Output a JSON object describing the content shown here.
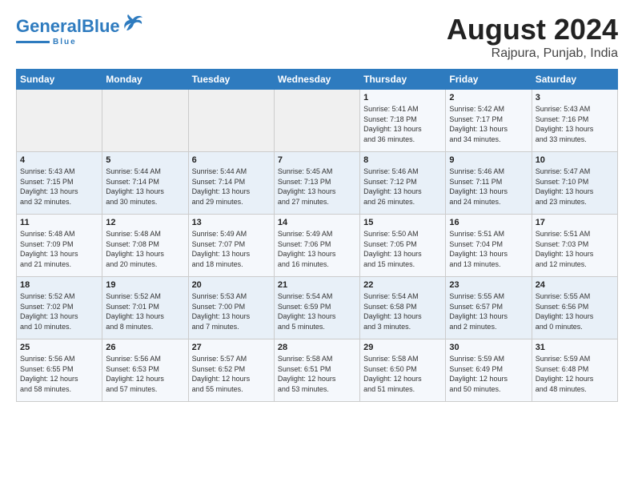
{
  "logo": {
    "name_part1": "General",
    "name_part2": "Blue",
    "tagline": "Blue"
  },
  "title": "August 2024",
  "subtitle": "Rajpura, Punjab, India",
  "days_of_week": [
    "Sunday",
    "Monday",
    "Tuesday",
    "Wednesday",
    "Thursday",
    "Friday",
    "Saturday"
  ],
  "weeks": [
    [
      {
        "day": "",
        "info": ""
      },
      {
        "day": "",
        "info": ""
      },
      {
        "day": "",
        "info": ""
      },
      {
        "day": "",
        "info": ""
      },
      {
        "day": "1",
        "info": "Sunrise: 5:41 AM\nSunset: 7:18 PM\nDaylight: 13 hours\nand 36 minutes."
      },
      {
        "day": "2",
        "info": "Sunrise: 5:42 AM\nSunset: 7:17 PM\nDaylight: 13 hours\nand 34 minutes."
      },
      {
        "day": "3",
        "info": "Sunrise: 5:43 AM\nSunset: 7:16 PM\nDaylight: 13 hours\nand 33 minutes."
      }
    ],
    [
      {
        "day": "4",
        "info": "Sunrise: 5:43 AM\nSunset: 7:15 PM\nDaylight: 13 hours\nand 32 minutes."
      },
      {
        "day": "5",
        "info": "Sunrise: 5:44 AM\nSunset: 7:14 PM\nDaylight: 13 hours\nand 30 minutes."
      },
      {
        "day": "6",
        "info": "Sunrise: 5:44 AM\nSunset: 7:14 PM\nDaylight: 13 hours\nand 29 minutes."
      },
      {
        "day": "7",
        "info": "Sunrise: 5:45 AM\nSunset: 7:13 PM\nDaylight: 13 hours\nand 27 minutes."
      },
      {
        "day": "8",
        "info": "Sunrise: 5:46 AM\nSunset: 7:12 PM\nDaylight: 13 hours\nand 26 minutes."
      },
      {
        "day": "9",
        "info": "Sunrise: 5:46 AM\nSunset: 7:11 PM\nDaylight: 13 hours\nand 24 minutes."
      },
      {
        "day": "10",
        "info": "Sunrise: 5:47 AM\nSunset: 7:10 PM\nDaylight: 13 hours\nand 23 minutes."
      }
    ],
    [
      {
        "day": "11",
        "info": "Sunrise: 5:48 AM\nSunset: 7:09 PM\nDaylight: 13 hours\nand 21 minutes."
      },
      {
        "day": "12",
        "info": "Sunrise: 5:48 AM\nSunset: 7:08 PM\nDaylight: 13 hours\nand 20 minutes."
      },
      {
        "day": "13",
        "info": "Sunrise: 5:49 AM\nSunset: 7:07 PM\nDaylight: 13 hours\nand 18 minutes."
      },
      {
        "day": "14",
        "info": "Sunrise: 5:49 AM\nSunset: 7:06 PM\nDaylight: 13 hours\nand 16 minutes."
      },
      {
        "day": "15",
        "info": "Sunrise: 5:50 AM\nSunset: 7:05 PM\nDaylight: 13 hours\nand 15 minutes."
      },
      {
        "day": "16",
        "info": "Sunrise: 5:51 AM\nSunset: 7:04 PM\nDaylight: 13 hours\nand 13 minutes."
      },
      {
        "day": "17",
        "info": "Sunrise: 5:51 AM\nSunset: 7:03 PM\nDaylight: 13 hours\nand 12 minutes."
      }
    ],
    [
      {
        "day": "18",
        "info": "Sunrise: 5:52 AM\nSunset: 7:02 PM\nDaylight: 13 hours\nand 10 minutes."
      },
      {
        "day": "19",
        "info": "Sunrise: 5:52 AM\nSunset: 7:01 PM\nDaylight: 13 hours\nand 8 minutes."
      },
      {
        "day": "20",
        "info": "Sunrise: 5:53 AM\nSunset: 7:00 PM\nDaylight: 13 hours\nand 7 minutes."
      },
      {
        "day": "21",
        "info": "Sunrise: 5:54 AM\nSunset: 6:59 PM\nDaylight: 13 hours\nand 5 minutes."
      },
      {
        "day": "22",
        "info": "Sunrise: 5:54 AM\nSunset: 6:58 PM\nDaylight: 13 hours\nand 3 minutes."
      },
      {
        "day": "23",
        "info": "Sunrise: 5:55 AM\nSunset: 6:57 PM\nDaylight: 13 hours\nand 2 minutes."
      },
      {
        "day": "24",
        "info": "Sunrise: 5:55 AM\nSunset: 6:56 PM\nDaylight: 13 hours\nand 0 minutes."
      }
    ],
    [
      {
        "day": "25",
        "info": "Sunrise: 5:56 AM\nSunset: 6:55 PM\nDaylight: 12 hours\nand 58 minutes."
      },
      {
        "day": "26",
        "info": "Sunrise: 5:56 AM\nSunset: 6:53 PM\nDaylight: 12 hours\nand 57 minutes."
      },
      {
        "day": "27",
        "info": "Sunrise: 5:57 AM\nSunset: 6:52 PM\nDaylight: 12 hours\nand 55 minutes."
      },
      {
        "day": "28",
        "info": "Sunrise: 5:58 AM\nSunset: 6:51 PM\nDaylight: 12 hours\nand 53 minutes."
      },
      {
        "day": "29",
        "info": "Sunrise: 5:58 AM\nSunset: 6:50 PM\nDaylight: 12 hours\nand 51 minutes."
      },
      {
        "day": "30",
        "info": "Sunrise: 5:59 AM\nSunset: 6:49 PM\nDaylight: 12 hours\nand 50 minutes."
      },
      {
        "day": "31",
        "info": "Sunrise: 5:59 AM\nSunset: 6:48 PM\nDaylight: 12 hours\nand 48 minutes."
      }
    ]
  ]
}
